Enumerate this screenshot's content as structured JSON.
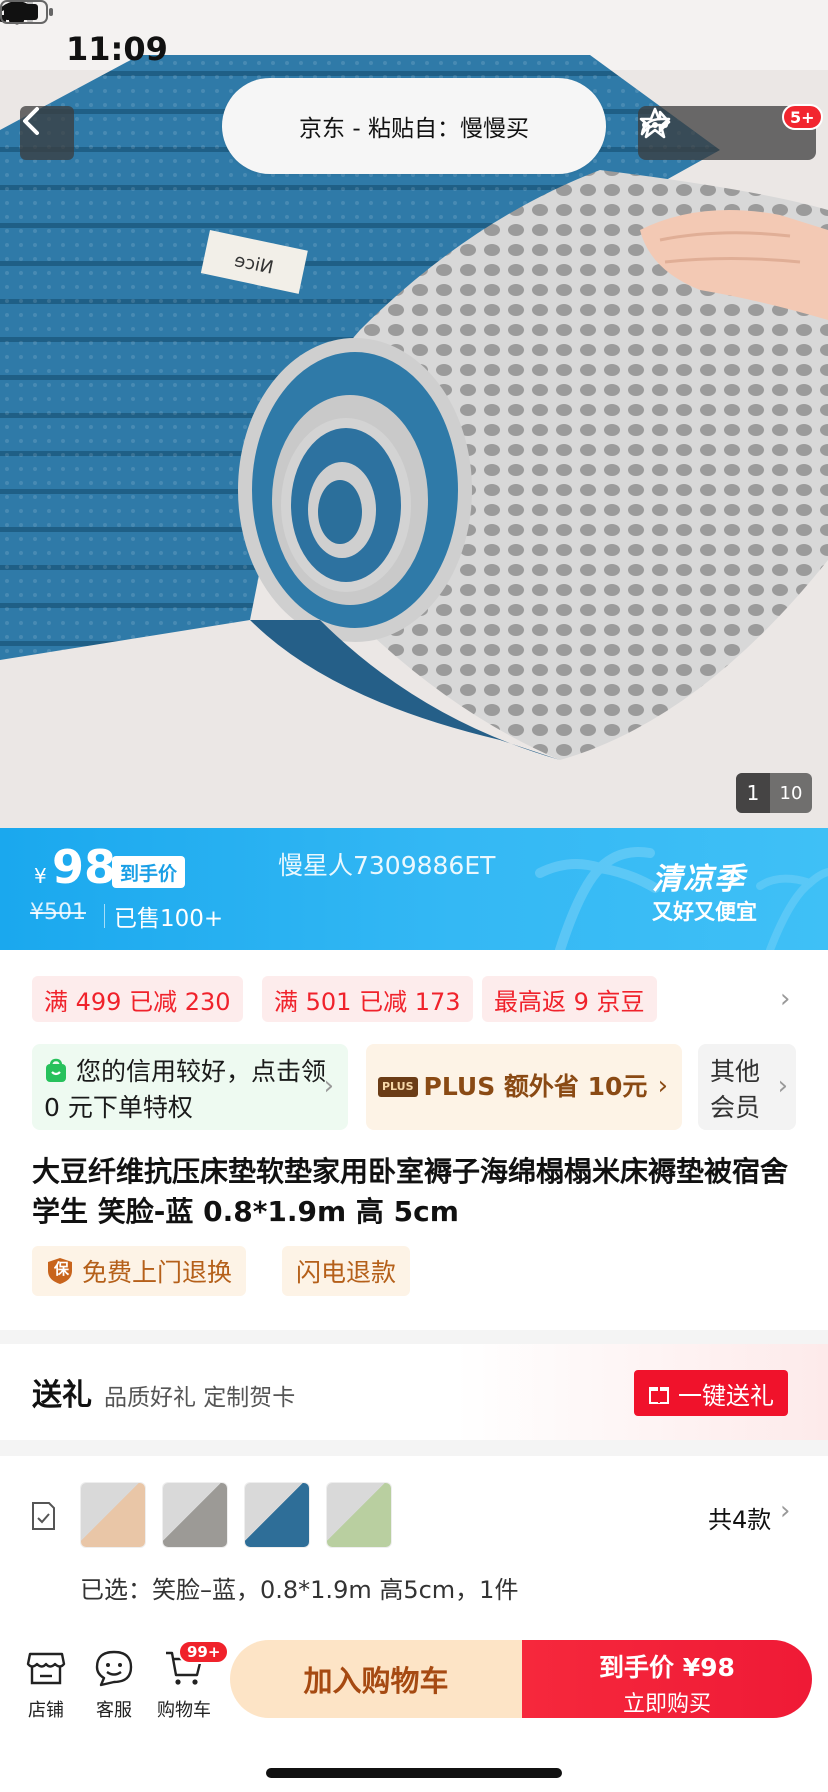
{
  "status_bar": {
    "time": "11:09"
  },
  "nav": {
    "source_label": "京东 - 粘贴自：慢慢买",
    "notification_badge": "5+",
    "image_counter": {
      "current": "1",
      "total": "10"
    }
  },
  "product_image": {
    "label_text": "NICE",
    "main_color": "#2e7aa6"
  },
  "price_bar": {
    "currency": "¥",
    "price": "98",
    "price_tag": "到手价",
    "original_price": "¥501",
    "sold": "已售100+",
    "watermark": "慢星人7309886ET",
    "season_title": "清凉季",
    "season_subtitle": "又好又便宜"
  },
  "coupons": [
    "满 499 已减 230",
    "满 501 已减 173",
    "最高返 9 京豆"
  ],
  "benefits": {
    "credit": "您的信用较好，点击领 0 元下单特权",
    "plus_badge": "PLUS",
    "plus_text": "PLUS 额外省 10元",
    "others": "其他会员"
  },
  "product_title": "大豆纤维抗压床垫软垫家用卧室褥子海绵榻榻米床褥垫被宿舍学生 笑脸-蓝 0.8*1.9m 高 5cm",
  "services": {
    "badge": "保",
    "free_return": "免费上门退换",
    "fast_refund": "闪电退款"
  },
  "gift": {
    "title": "送礼",
    "subtitle": "品质好礼 定制贺卡",
    "button": "一键送礼"
  },
  "variants": {
    "count": "共4款",
    "selected": "已选：笑脸–蓝，0.8*1.9m 高5cm，1件",
    "thumb_colors": [
      "#e9c6a7",
      "#9c9a96",
      "#2e6e98",
      "#b9cfa0"
    ]
  },
  "bottom_bar": {
    "store": "店铺",
    "service": "客服",
    "cart": "购物车",
    "cart_badge": "99+",
    "add_to_cart": "加入购物车",
    "buy_price": "到手价 ¥98",
    "buy_now": "立即购买"
  },
  "colors": {
    "accent_red": "#f0222b",
    "price_blue": "#1aa8ee",
    "plus_brown": "#8a4a14"
  }
}
